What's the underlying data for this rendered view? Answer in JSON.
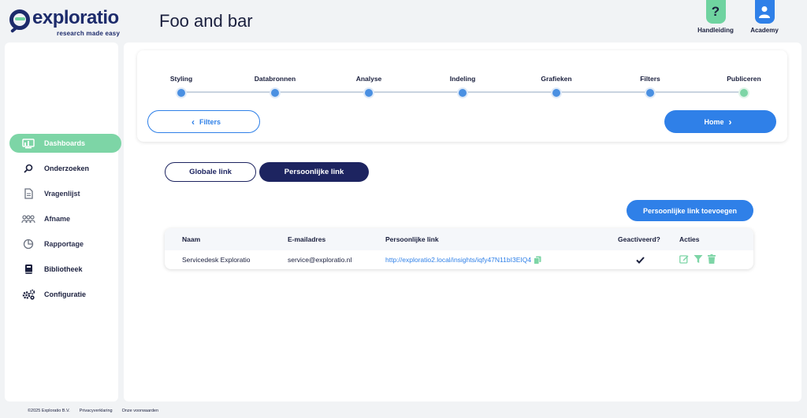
{
  "brand": {
    "name": "exploratio",
    "tagline": "research made easy"
  },
  "page_title": "Foo and bar",
  "top_actions": [
    {
      "label": "Handleiding",
      "icon": "question-icon"
    },
    {
      "label": "Academy",
      "icon": "user-icon"
    }
  ],
  "sidebar": {
    "items": [
      {
        "label": "Dashboards",
        "icon": "dashboard-icon",
        "active": true
      },
      {
        "label": "Onderzoeken",
        "icon": "search-icon"
      },
      {
        "label": "Vragenlijst",
        "icon": "document-icon"
      },
      {
        "label": "Afname",
        "icon": "people-icon"
      },
      {
        "label": "Rapportage",
        "icon": "pie-chart-icon"
      },
      {
        "label": "Bibliotheek",
        "icon": "book-icon"
      },
      {
        "label": "Configuratie",
        "icon": "cogs-icon"
      }
    ]
  },
  "stepper": {
    "steps": [
      "Styling",
      "Databronnen",
      "Analyse",
      "Indeling",
      "Grafieken",
      "Filters",
      "Publiceren"
    ],
    "current_step": "Publiceren"
  },
  "nav_buttons": {
    "prev": "Filters",
    "next": "Home"
  },
  "tabs": {
    "global": "Globale link",
    "personal": "Persoonlijke link",
    "active": "Persoonlijke link"
  },
  "add_button": "Persoonlijke link toevoegen",
  "table": {
    "headers": [
      "Naam",
      "E-mailadres",
      "Persoonlijke link",
      "Geactiveerd?",
      "Acties"
    ],
    "rows": [
      {
        "name": "Servicedesk Exploratio",
        "email": "service@exploratio.nl",
        "link": "http://exploratio2.local/insights/iqfy47N11bI3EIQ4",
        "activated": true
      }
    ]
  },
  "footer": {
    "copyright": "©2025 Exploratio B.V.",
    "privacy": "Privacyverklaring",
    "terms": "Onze voorwaarden"
  },
  "colors": {
    "accent": "#2f80e8",
    "navy": "#1d2460",
    "success": "#7dd5a6"
  }
}
